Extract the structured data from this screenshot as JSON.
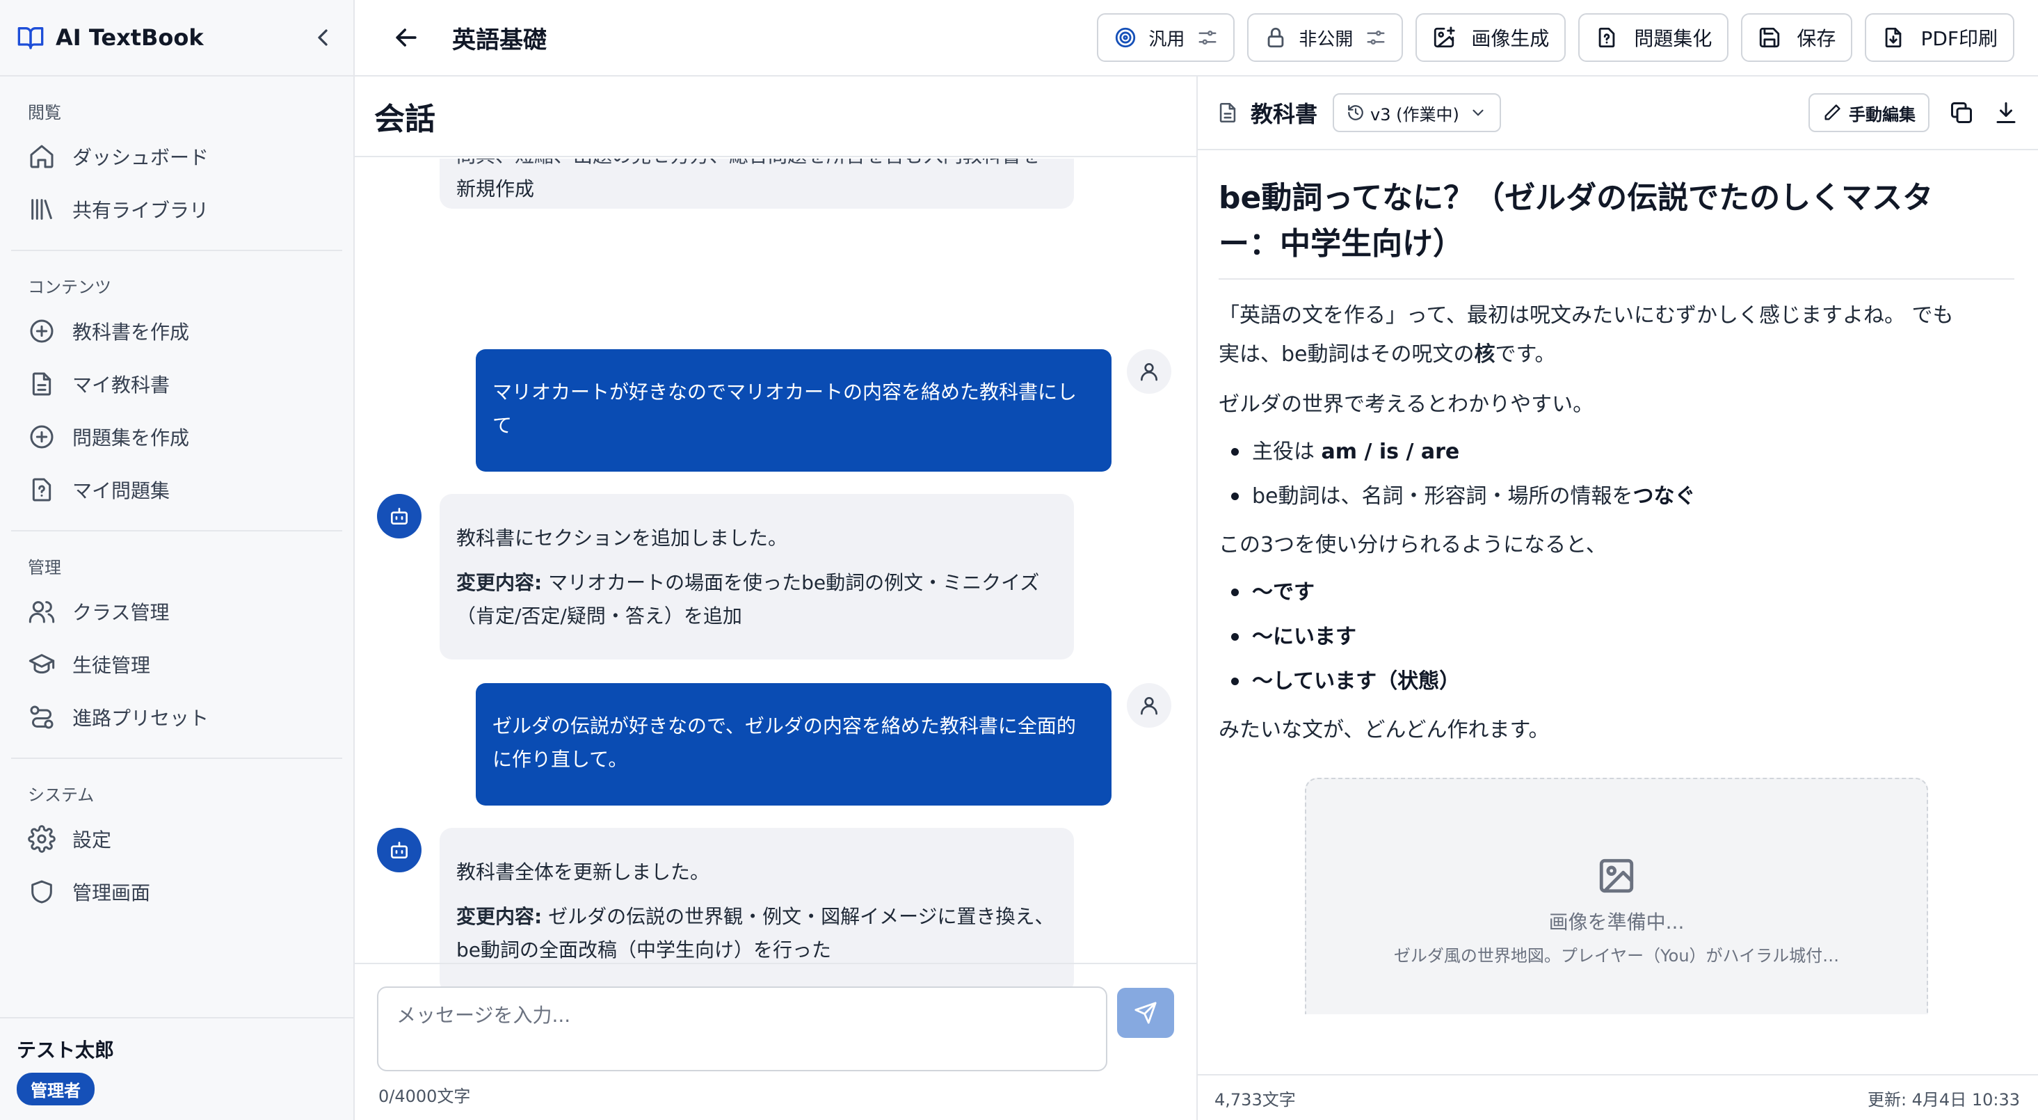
{
  "app": {
    "brand": "AI TextBook",
    "colors": {
      "accent": "#1550b8",
      "user_bubble": "#0a4cb3",
      "ai_bubble": "#f1f2f6",
      "send_disabled": "#86a9e0"
    }
  },
  "sidebar": {
    "sections": [
      {
        "label": "閲覧",
        "items": [
          {
            "label": "ダッシュボード",
            "icon": "home-icon"
          },
          {
            "label": "共有ライブラリ",
            "icon": "library-icon"
          }
        ]
      },
      {
        "label": "コンテンツ",
        "items": [
          {
            "label": "教科書を作成",
            "icon": "plus-circle-icon"
          },
          {
            "label": "マイ教科書",
            "icon": "file-text-icon"
          },
          {
            "label": "問題集を作成",
            "icon": "plus-circle-icon"
          },
          {
            "label": "マイ問題集",
            "icon": "file-question-icon"
          }
        ]
      },
      {
        "label": "管理",
        "items": [
          {
            "label": "クラス管理",
            "icon": "users-icon"
          },
          {
            "label": "生徒管理",
            "icon": "graduation-cap-icon"
          },
          {
            "label": "進路プリセット",
            "icon": "route-icon"
          }
        ]
      },
      {
        "label": "システム",
        "items": [
          {
            "label": "設定",
            "icon": "gear-icon"
          },
          {
            "label": "管理画面",
            "icon": "shield-icon"
          }
        ]
      }
    ],
    "user": {
      "name": "テスト太郎",
      "role": "管理者"
    }
  },
  "header": {
    "title": "英語基礎",
    "actions": {
      "mode": "汎用",
      "visibility": "非公開",
      "image_gen": "画像生成",
      "to_questions": "問題集化",
      "save": "保存",
      "pdf": "PDF印刷"
    }
  },
  "chat": {
    "title": "会話",
    "messages": {
      "m0": {
        "role": "ai",
        "line1": "問典、短縮、出題の見せ方方、総合問題を所含を含む入門教科書を",
        "line2": "新規作成"
      },
      "m1": {
        "role": "user",
        "line1": "マリオカートが好きなのでマリオカートの内容を絡めた教科書にし",
        "line2": "て"
      },
      "m2": {
        "role": "ai",
        "text": "教科書にセクションを追加しました。",
        "change_label": "変更内容:",
        "change_line1": " マリオカートの場面を使ったbe動詞の例文・ミニクイズ",
        "change_line2": "（肯定/否定/疑問・答え）を追加"
      },
      "m3": {
        "role": "user",
        "line1": "ゼルダの伝説が好きなので、ゼルダの内容を絡めた教科書に全面的",
        "line2": "に作り直して。"
      },
      "m4": {
        "role": "ai",
        "text": "教科書全体を更新しました。",
        "change_label": "変更内容:",
        "change_line1": " ゼルダの伝説の世界観・例文・図解イメージに置き換え、",
        "change_line2": "be動詞の全面改稿（中学生向け）を行った"
      }
    },
    "input": {
      "placeholder": "メッセージを入力...",
      "count": "0/4000文字"
    }
  },
  "document": {
    "title": "教科書",
    "version": "v3 (作業中)",
    "edit_label": "手動編集",
    "h1_line1": "be動詞ってなに？（ゼルダの伝説でたのしくマスタ",
    "h1_line2": "ー：中学生向け）",
    "p1a": "「英語の文を作る」って、最初は呪文みたいにむずかしく感じますよね。 でも",
    "p1b_pre": "実は、be動詞はその呪文の",
    "p1b_bold": "核",
    "p1b_post": "です。",
    "p2": "ゼルダの世界で考えるとわかりやすい。",
    "list1": {
      "i1_pre": "主役は ",
      "i1_bold": "am / is / are",
      "i2_pre": "be動詞は、名詞・形容詞・場所の情報を",
      "i2_bold": "つなぐ"
    },
    "p3": "この3つを使い分けられるようになると、",
    "list2": [
      "〜です",
      "〜にいます",
      "〜しています（状態）"
    ],
    "p4": "みたいな文が、どんどん作れます。",
    "image": {
      "status": "画像を準備中...",
      "caption": "ゼルダ風の世界地図。プレイヤー（You）がハイラル城付…"
    },
    "footer": {
      "chars": "4,733文字",
      "updated": "更新: 4月4日 10:33"
    }
  }
}
